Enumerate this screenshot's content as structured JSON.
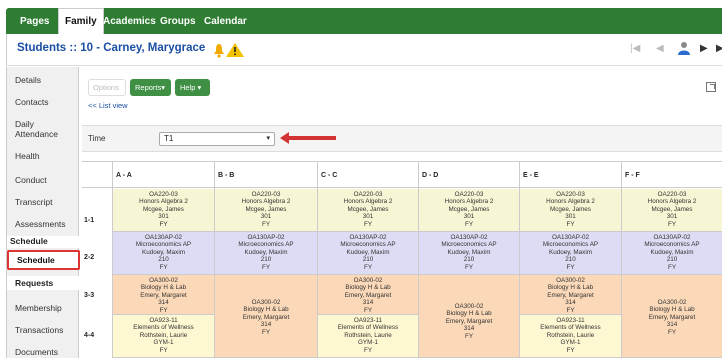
{
  "nav": {
    "tabs": [
      "Pages",
      "Family",
      "Academics",
      "Groups",
      "Calendar"
    ],
    "active": "Family"
  },
  "header": {
    "title": "Students :: 10 - Carney, Marygrace"
  },
  "sidebar": {
    "items": [
      "Details",
      "Contacts",
      "Daily Attendance",
      "Health",
      "Conduct",
      "Transcript",
      "Assessments"
    ],
    "section_schedule": "Schedule",
    "active_item": "Schedule",
    "section_requests": "Requests",
    "items_bottom": [
      "Membership",
      "Transactions",
      "Documents"
    ]
  },
  "toolbar": {
    "options": "Options",
    "reports": "Reports▾",
    "help": "Help ▾",
    "list_view": "<< List view"
  },
  "time": {
    "label": "Time",
    "value": "T1"
  },
  "colors": {
    "nav_green": "#2e7d32",
    "title_blue": "#1a4fa3",
    "highlight_red": "#d33333",
    "yellow_cell": "#f6f6d4",
    "blue_cell": "#dcdcf4",
    "orange_cell": "#fbd9b8"
  },
  "grid": {
    "columns": [
      "A - A",
      "B - B",
      "C - C",
      "D - D",
      "E - E",
      "F - F"
    ],
    "rows": [
      "1-1",
      "2-2",
      "3-3",
      "4-4"
    ],
    "alg": [
      "OA220-03",
      "Honors Algebra 2",
      "Mcgee, James",
      "301",
      "FY"
    ],
    "micro": [
      "OA130AP-02",
      "Microeconomics AP",
      "Kudoey, Maxim",
      "210",
      "FY"
    ],
    "bio": [
      "OA300-02",
      "Biology H & Lab",
      "Emery, Margaret",
      "314",
      "FY"
    ],
    "wellness": [
      "OA923-11",
      "Elements of Wellness",
      "Rothstein, Laurie",
      "GYM-1",
      "FY"
    ]
  }
}
